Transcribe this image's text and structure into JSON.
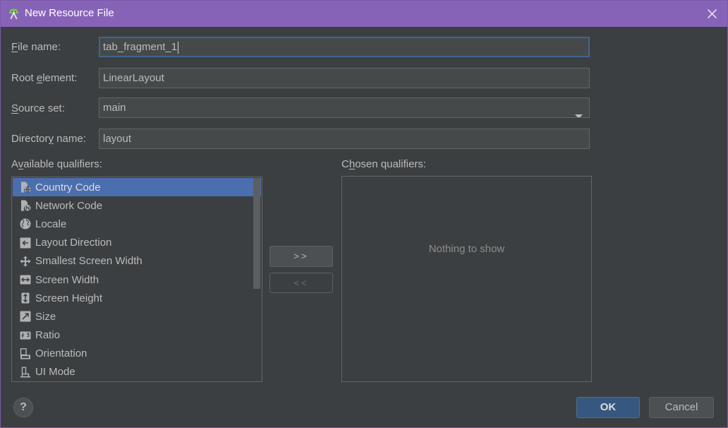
{
  "window": {
    "title": "New Resource File",
    "app_icon": "android-studio-icon",
    "close_icon": "close-icon"
  },
  "form": {
    "file_name": {
      "label": "File name:",
      "mnemonic": "F",
      "value": "tab_fragment_1",
      "focused": true
    },
    "root_element": {
      "label": "Root element:",
      "mnemonic": "e",
      "value": "LinearLayout"
    },
    "source_set": {
      "label": "Source set:",
      "mnemonic": "S",
      "value": "main",
      "icon": "chevron-down-icon"
    },
    "directory_name": {
      "label": "Directory name:",
      "mnemonic": "y",
      "value": "layout"
    }
  },
  "available_qualifiers": {
    "label": "Available qualifiers:",
    "mnemonic": "v",
    "selected": "Country Code",
    "items": [
      {
        "label": "Country Code",
        "icon": "country-code-icon"
      },
      {
        "label": "Network Code",
        "icon": "network-code-icon"
      },
      {
        "label": "Locale",
        "icon": "locale-icon"
      },
      {
        "label": "Layout Direction",
        "icon": "layout-direction-icon"
      },
      {
        "label": "Smallest Screen Width",
        "icon": "smallest-screen-width-icon"
      },
      {
        "label": "Screen Width",
        "icon": "screen-width-icon"
      },
      {
        "label": "Screen Height",
        "icon": "screen-height-icon"
      },
      {
        "label": "Size",
        "icon": "size-icon"
      },
      {
        "label": "Ratio",
        "icon": "ratio-icon"
      },
      {
        "label": "Orientation",
        "icon": "orientation-icon"
      },
      {
        "label": "UI Mode",
        "icon": "ui-mode-icon"
      }
    ]
  },
  "transfer": {
    "add_label": ">>",
    "remove_label": "<<",
    "remove_enabled": false
  },
  "chosen_qualifiers": {
    "label": "Chosen qualifiers:",
    "mnemonic": "h",
    "empty_text": "Nothing to show",
    "items": []
  },
  "footer": {
    "help_label": "?",
    "ok_label": "OK",
    "cancel_label": "Cancel"
  },
  "colors": {
    "title_bar": "#8763b8",
    "background": "#3c3f41",
    "text": "#bbbbbb",
    "selection": "#4b6eaf",
    "focus_ring": "#40668e",
    "default_button": "#365880",
    "muted_text": "#8c8c8c"
  }
}
